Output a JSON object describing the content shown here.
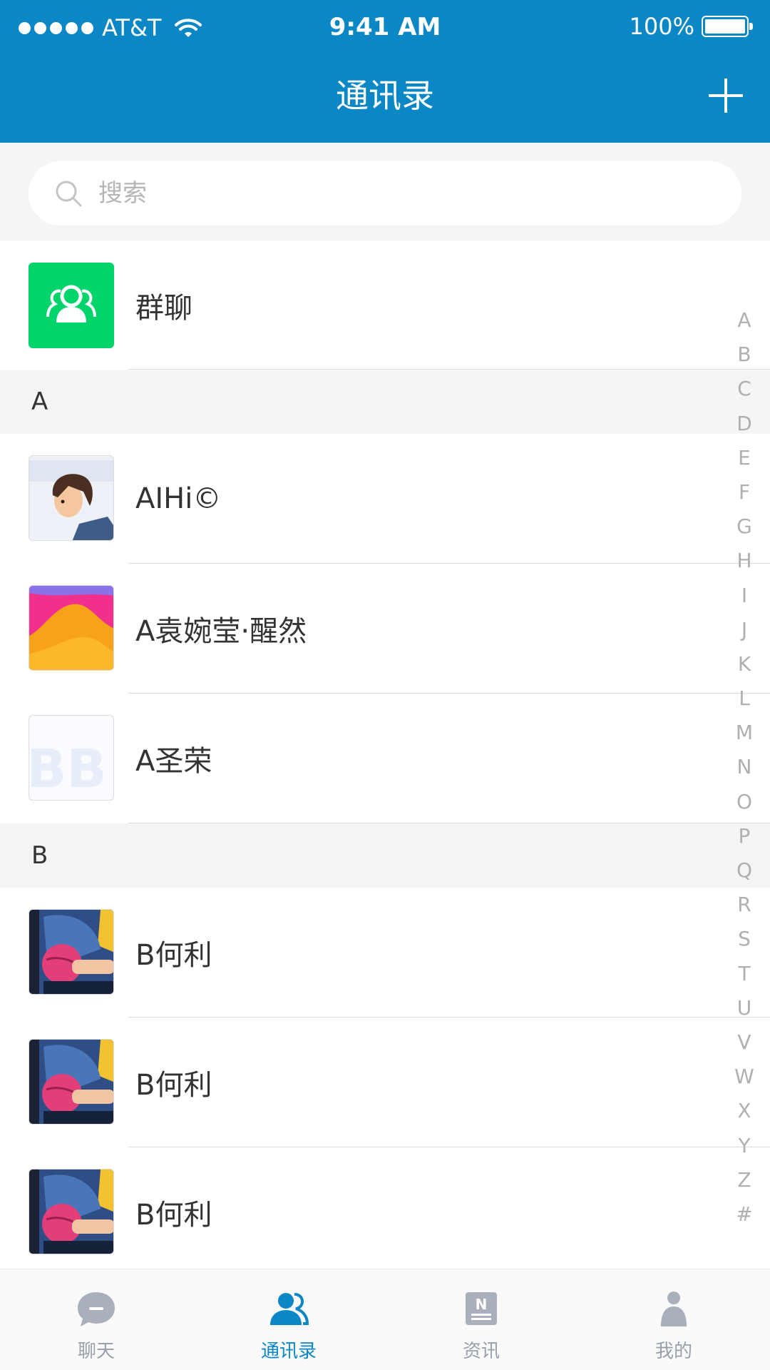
{
  "status_bar": {
    "carrier": "AT&T",
    "time": "9:41 AM",
    "battery": "100%"
  },
  "header": {
    "title": "通讯录",
    "add_icon": "plus-icon"
  },
  "search": {
    "placeholder": "搜索"
  },
  "group_chat": {
    "label": "群聊",
    "icon": "group-icon"
  },
  "sections": [
    {
      "letter": "A",
      "contacts": [
        {
          "name": "AIHi©",
          "avatar": "boy-illustration"
        },
        {
          "name": "A袁婉莹·醒然",
          "avatar": "pink-orange-gradient"
        },
        {
          "name": "A圣荣",
          "avatar": "bb-logo"
        }
      ]
    },
    {
      "letter": "B",
      "contacts": [
        {
          "name": "B何利",
          "avatar": "basketball-player"
        },
        {
          "name": "B何利",
          "avatar": "basketball-player"
        },
        {
          "name": "B何利",
          "avatar": "basketball-player"
        }
      ]
    }
  ],
  "index_letters": [
    "A",
    "B",
    "C",
    "D",
    "E",
    "F",
    "G",
    "H",
    "I",
    "J",
    "K",
    "L",
    "M",
    "N",
    "O",
    "P",
    "Q",
    "R",
    "S",
    "T",
    "U",
    "V",
    "W",
    "X",
    "Y",
    "Z",
    "#"
  ],
  "tabs": [
    {
      "label": "聊天",
      "icon": "chat-bubble-icon",
      "active": false
    },
    {
      "label": "通讯录",
      "icon": "contacts-icon",
      "active": true
    },
    {
      "label": "资讯",
      "icon": "news-icon",
      "active": false
    },
    {
      "label": "我的",
      "icon": "profile-icon",
      "active": false
    }
  ],
  "colors": {
    "primary": "#0a87c4",
    "group_green": "#00d46a",
    "inactive": "#9aa0aa",
    "section_bg": "#f5f5f5"
  }
}
